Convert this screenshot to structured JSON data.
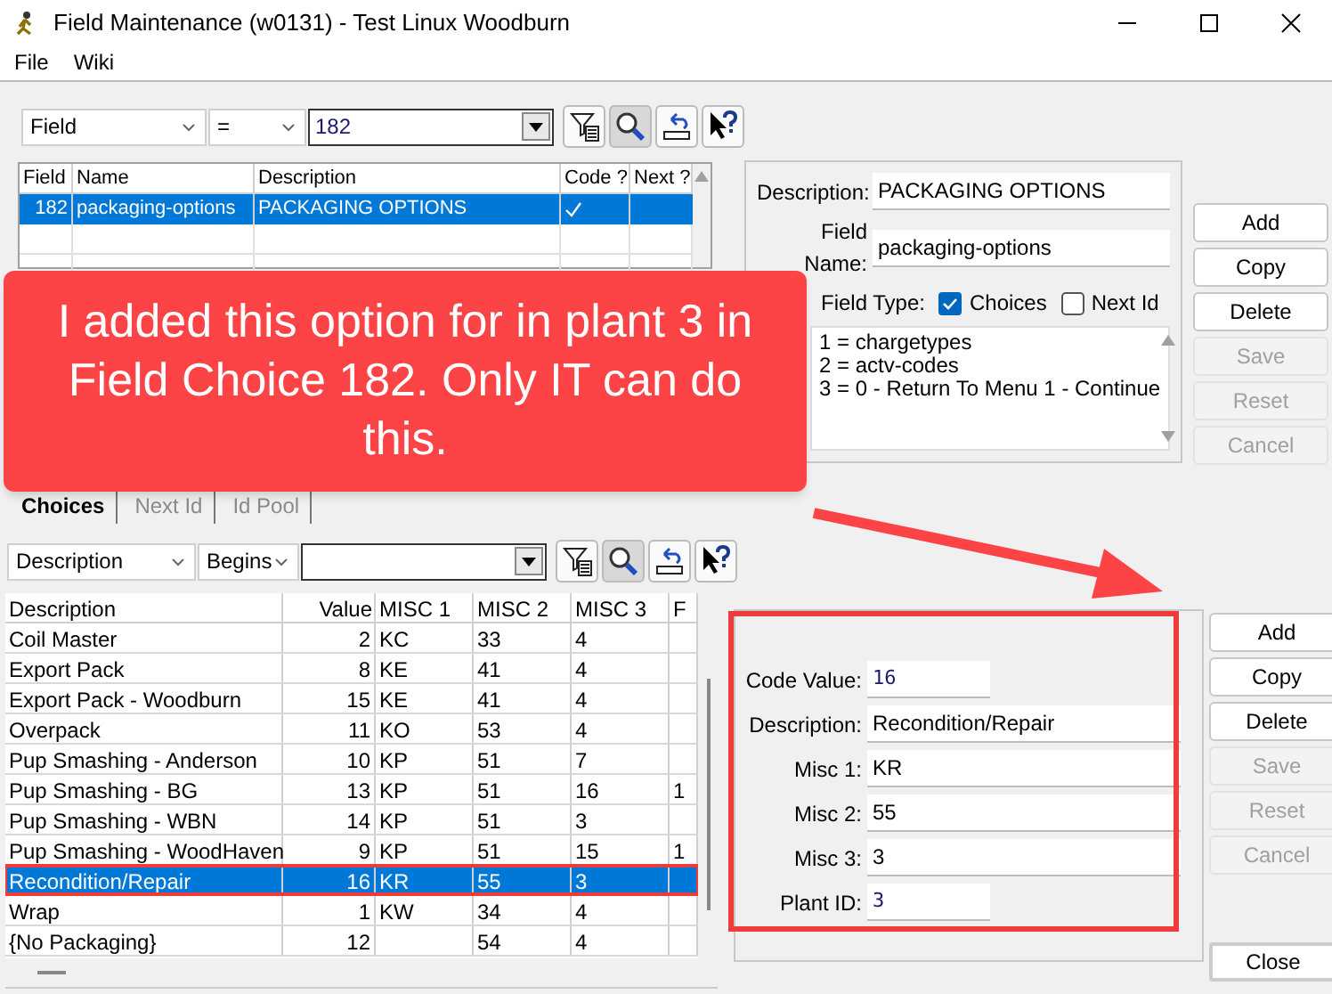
{
  "window": {
    "title": "Field Maintenance (w0131) - Test Linux Woodburn"
  },
  "menu": [
    "File",
    "Wiki"
  ],
  "field_search": {
    "field": "Field",
    "operator": "=",
    "value": "182"
  },
  "fields_table": {
    "columns": [
      "Field",
      "Name",
      "Description",
      "Code ?",
      "Next ?"
    ],
    "rows": [
      {
        "field": "182",
        "name": "packaging-options",
        "description": "PACKAGING OPTIONS",
        "code": true,
        "next": false,
        "selected": true
      }
    ]
  },
  "field_detail": {
    "description_label": "Description:",
    "description": "PACKAGING OPTIONS",
    "field_name_label": "Field Name:",
    "field_name": "packaging-options",
    "field_type_label": "Field Type:",
    "choices": {
      "label": "Choices",
      "checked": true
    },
    "next_id": {
      "label": "Next Id",
      "checked": false
    },
    "choice_lines": [
      "1 = chargetypes",
      "2 = actv-codes",
      "3 = 0 - Return To Menu 1 - Continue"
    ]
  },
  "field_buttons": [
    {
      "label": "Add",
      "disabled": false
    },
    {
      "label": "Copy",
      "disabled": false
    },
    {
      "label": "Delete",
      "disabled": false
    },
    {
      "label": "Save",
      "disabled": true
    },
    {
      "label": "Reset",
      "disabled": true
    },
    {
      "label": "Cancel",
      "disabled": true
    }
  ],
  "tabs": [
    {
      "label": "Choices",
      "selected": true
    },
    {
      "label": "Next Id",
      "selected": false
    },
    {
      "label": "Id Pool",
      "selected": false
    }
  ],
  "choice_search": {
    "field": "Description",
    "operator": "Begins"
  },
  "choices_table": {
    "columns": [
      "Description",
      "Value",
      "MISC 1",
      "MISC 2",
      "MISC 3",
      "F"
    ],
    "rows": [
      {
        "description": "Coil Master",
        "value": "2",
        "misc_1": "KC",
        "misc_2": "33",
        "misc_3": "4",
        "selected": false
      },
      {
        "description": "Export Pack",
        "value": "8",
        "misc_1": "KE",
        "misc_2": "41",
        "misc_3": "4",
        "selected": false
      },
      {
        "description": "Export Pack - Woodburn",
        "value": "15",
        "misc_1": "KE",
        "misc_2": "41",
        "misc_3": "4",
        "selected": false
      },
      {
        "description": "Overpack",
        "value": "11",
        "misc_1": "KO",
        "misc_2": "53",
        "misc_3": "4",
        "selected": false
      },
      {
        "description": "Pup Smashing - Anderson",
        "value": "10",
        "misc_1": "KP",
        "misc_2": "51",
        "misc_3": "7",
        "selected": false
      },
      {
        "description": "Pup Smashing - BG",
        "value": "13",
        "misc_1": "KP",
        "misc_2": "51",
        "misc_3": "16",
        "column_6": "1",
        "selected": false
      },
      {
        "description": "Pup Smashing - WBN",
        "value": "14",
        "misc_1": "KP",
        "misc_2": "51",
        "misc_3": "3",
        "selected": false
      },
      {
        "description": "Pup Smashing - WoodHaven",
        "value": "9",
        "misc_1": "KP",
        "misc_2": "51",
        "misc_3": "15",
        "column_6": "1",
        "selected": false
      },
      {
        "description": "Recondition/Repair",
        "value": "16",
        "misc_1": "KR",
        "misc_2": "55",
        "misc_3": "3",
        "selected": true
      },
      {
        "description": "Wrap",
        "value": "1",
        "misc_1": "KW",
        "misc_2": "34",
        "misc_3": "4",
        "selected": false
      },
      {
        "description": "{No Packaging}",
        "value": "12",
        "misc_2": "54",
        "misc_3": "4",
        "selected": false
      }
    ]
  },
  "choice_detail": [
    {
      "label": "Code Value:",
      "value": "16",
      "kind": "numeric"
    },
    {
      "label": "Description:",
      "value": "Recondition/Repair",
      "kind": "text"
    },
    {
      "label": "Misc 1:",
      "value": "KR",
      "kind": "text"
    },
    {
      "label": "Misc 2:",
      "value": "55",
      "kind": "text"
    },
    {
      "label": "Misc 3:",
      "value": "3",
      "kind": "text"
    },
    {
      "label": "Plant ID:",
      "value": "3",
      "kind": "numeric"
    }
  ],
  "choice_buttons": [
    {
      "label": "Add",
      "disabled": false
    },
    {
      "label": "Copy",
      "disabled": false
    },
    {
      "label": "Delete",
      "disabled": false
    },
    {
      "label": "Save",
      "disabled": true
    },
    {
      "label": "Reset",
      "disabled": true
    },
    {
      "label": "Cancel",
      "disabled": true
    }
  ],
  "close_button": "Close",
  "callout": {
    "text": "I added this option for in plant 3 in Field Choice 182. Only IT can do this."
  }
}
